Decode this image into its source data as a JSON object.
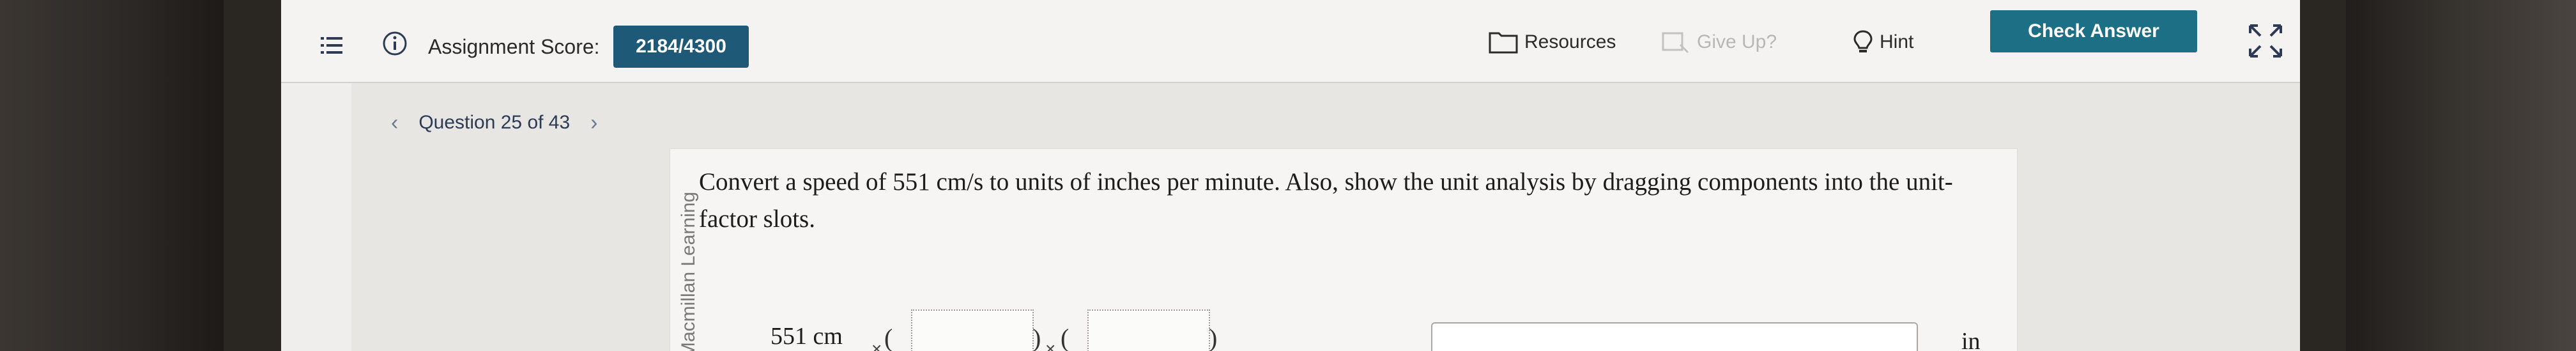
{
  "header": {
    "score_label": "Assignment Score:",
    "score_value": "2184/4300",
    "resources_label": "Resources",
    "giveup_label": "Give Up?",
    "hint_label": "Hint",
    "check_label": "Check Answer"
  },
  "navigation": {
    "question_label": "Question 25 of 43"
  },
  "question": {
    "publisher": "Macmillan Learning",
    "text": "Convert a speed of 551 cm/s to units of inches per minute. Also, show the unit analysis by dragging components into the unit-factor slots.",
    "given_value": "551 cm",
    "answer_unit": "in"
  },
  "colors": {
    "score_badge": "#1e5a78",
    "check_button": "#1d6f86"
  }
}
